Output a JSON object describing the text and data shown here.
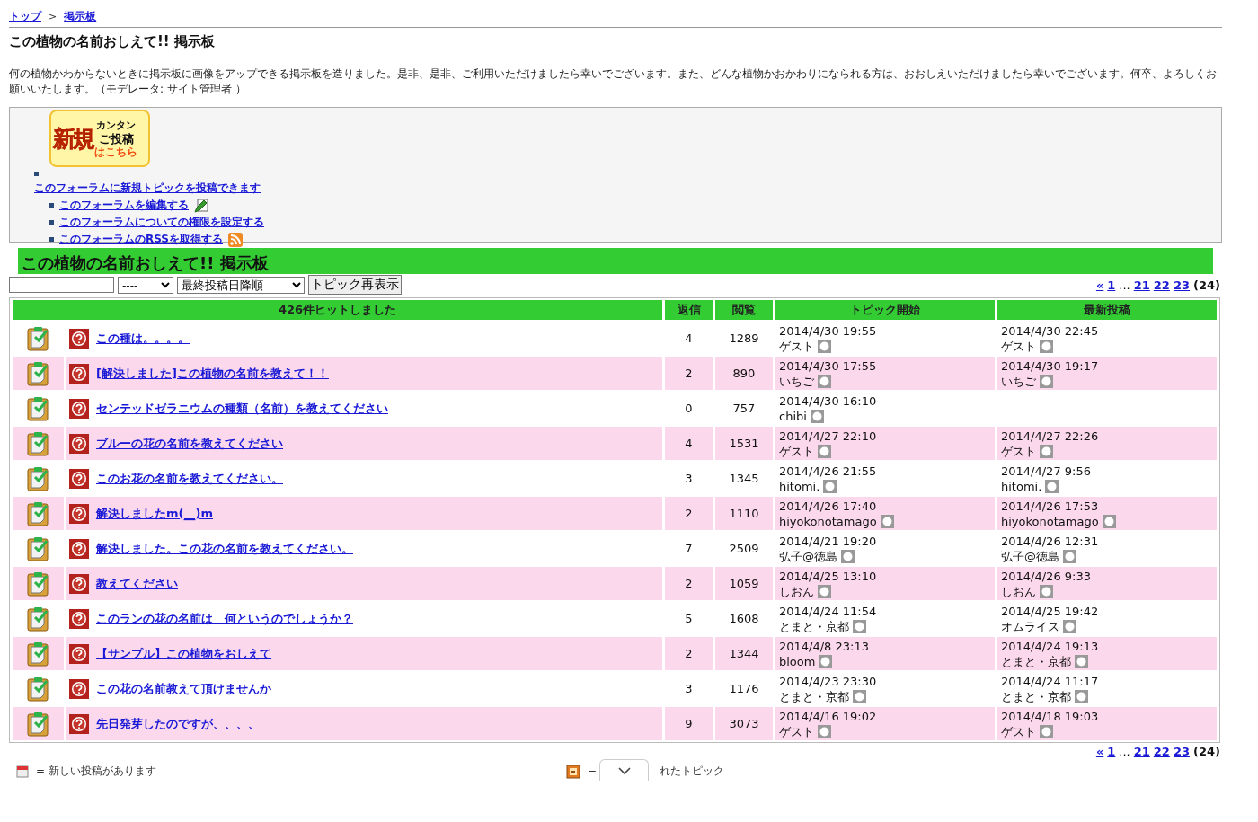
{
  "breadcrumb": [
    {
      "label": "トップ"
    },
    {
      "label": "掲示板"
    }
  ],
  "breadcrumb_separator": ">",
  "page_title": "この植物の名前おしえて!! 掲示板",
  "description": "何の植物かわからないときに掲示板に画像をアップできる掲示板を造りました。是非、是非、ご利用いただけましたら幸いでございます。また、どんな植物かおかわりになられる方は、おおしえいただけましたら幸いでございます。何卒、よろしくお願いいたします。（モデレータ: サイト管理者 ）",
  "new_post_banner": {
    "big": "新規",
    "lines": [
      "カンタン",
      "ご投稿",
      "はこちら"
    ]
  },
  "actions": [
    {
      "label": "このフォーラムに新規トピックを投稿できます",
      "kind": "new_topic"
    },
    {
      "label": "このフォーラムを編集する",
      "kind": "edit"
    },
    {
      "label": "このフォーラムについての権限を設定する",
      "kind": "plain"
    },
    {
      "label": "このフォーラムのRSSを取得する",
      "kind": "rss"
    }
  ],
  "forum_title": "この植物の名前おしえて!! 掲示板",
  "filters": {
    "selects": [
      {
        "value": "----"
      },
      {
        "value": "最終投稿日降順"
      }
    ],
    "button": "トピック再表示"
  },
  "pagination_top": [
    {
      "label": "«",
      "kind": "link"
    },
    {
      "label": "1",
      "kind": "link"
    },
    {
      "label": "...",
      "kind": "gap"
    },
    {
      "label": "21",
      "kind": "link"
    },
    {
      "label": "22",
      "kind": "link"
    },
    {
      "label": "23",
      "kind": "link"
    },
    {
      "label": "(24)",
      "kind": "current"
    }
  ],
  "table": {
    "columns": [
      "426件ヒットしました",
      "返信",
      "閲覧",
      "トピック開始",
      "最新投稿"
    ],
    "rows": [
      {
        "title": "この種は。。。。",
        "replies": "4",
        "views": "1289",
        "start": {
          "date": "2014/4/30 19:55",
          "user": "ゲスト"
        },
        "last": {
          "date": "2014/4/30 22:45",
          "user": "ゲスト"
        }
      },
      {
        "title": "[解決しました]この植物の名前を教えて！！",
        "replies": "2",
        "views": "890",
        "start": {
          "date": "2014/4/30 17:55",
          "user": "いちご"
        },
        "last": {
          "date": "2014/4/30 19:17",
          "user": "いちご"
        }
      },
      {
        "title": "センテッドゼラニウムの種類（名前）を教えてください",
        "replies": "0",
        "views": "757",
        "start": {
          "date": "2014/4/30 16:10",
          "user": "chibi"
        }
      },
      {
        "title": "ブルーの花の名前を教えてください",
        "replies": "4",
        "views": "1531",
        "start": {
          "date": "2014/4/27 22:10",
          "user": "ゲスト"
        },
        "last": {
          "date": "2014/4/27 22:26",
          "user": "ゲスト"
        }
      },
      {
        "title": "このお花の名前を教えてください。",
        "replies": "3",
        "views": "1345",
        "start": {
          "date": "2014/4/26 21:55",
          "user": "hitomi."
        },
        "last": {
          "date": "2014/4/27 9:56",
          "user": "hitomi."
        }
      },
      {
        "title": "解決しましたm(__)m",
        "replies": "2",
        "views": "1110",
        "start": {
          "date": "2014/4/26 17:40",
          "user": "hiyokonotamago"
        },
        "last": {
          "date": "2014/4/26 17:53",
          "user": "hiyokonotamago"
        }
      },
      {
        "title": "解決しました。この花の名前を教えてください。",
        "replies": "7",
        "views": "2509",
        "start": {
          "date": "2014/4/21 19:20",
          "user": "弘子@徳島"
        },
        "last": {
          "date": "2014/4/26 12:31",
          "user": "弘子@徳島"
        }
      },
      {
        "title": "教えてください",
        "replies": "2",
        "views": "1059",
        "start": {
          "date": "2014/4/25 13:10",
          "user": "しおん"
        },
        "last": {
          "date": "2014/4/26 9:33",
          "user": "しおん"
        }
      },
      {
        "title": "このランの花の名前は　何というのでしょうか？",
        "replies": "5",
        "views": "1608",
        "start": {
          "date": "2014/4/24 11:54",
          "user": "とまと・京都"
        },
        "last": {
          "date": "2014/4/25 19:42",
          "user": "オムライス"
        }
      },
      {
        "title": "【サンプル】この植物をおしえて",
        "replies": "2",
        "views": "1344",
        "start": {
          "date": "2014/4/8 23:13",
          "user": "bloom"
        },
        "last": {
          "date": "2014/4/24 19:13",
          "user": "とまと・京都"
        }
      },
      {
        "title": "この花の名前教えて頂けませんか",
        "replies": "3",
        "views": "1176",
        "start": {
          "date": "2014/4/23 23:30",
          "user": "とまと・京都"
        },
        "last": {
          "date": "2014/4/24 11:17",
          "user": "とまと・京都"
        }
      },
      {
        "title": "先日発芽したのですが、、、、",
        "replies": "9",
        "views": "3073",
        "start": {
          "date": "2014/4/16 19:02",
          "user": "ゲスト"
        },
        "last": {
          "date": "2014/4/18 19:03",
          "user": "ゲスト"
        }
      }
    ]
  },
  "pagination_bottom": [
    {
      "label": "«",
      "kind": "link"
    },
    {
      "label": "1",
      "kind": "link"
    },
    {
      "label": "...",
      "kind": "gap"
    },
    {
      "label": "21",
      "kind": "link"
    },
    {
      "label": "22",
      "kind": "link"
    },
    {
      "label": "23",
      "kind": "link"
    },
    {
      "label": "(24)",
      "kind": "current"
    }
  ],
  "legend": [
    {
      "kind": "new",
      "parts": [
        "= 新しい投稿があります"
      ]
    },
    {
      "kind": "locked",
      "parts": [
        "=",
        "れたトピック"
      ]
    }
  ]
}
